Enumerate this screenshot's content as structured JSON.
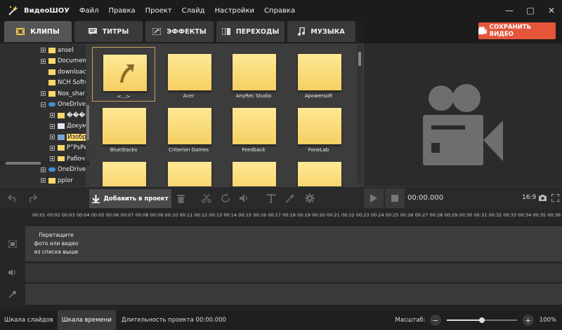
{
  "app": {
    "name": "ВидеоШОУ"
  },
  "menu": [
    "Файл",
    "Правка",
    "Проект",
    "Слайд",
    "Настройки",
    "Справка"
  ],
  "tabs": [
    {
      "label": "КЛИПЫ",
      "icon": "film-icon",
      "active": true
    },
    {
      "label": "ТИТРЫ",
      "icon": "chat-icon",
      "active": false
    },
    {
      "label": "ЭФФЕКТЫ",
      "icon": "sparkle-icon",
      "active": false
    },
    {
      "label": "ПЕРЕХОДЫ",
      "icon": "transition-icon",
      "active": false
    },
    {
      "label": "МУЗЫКА",
      "icon": "music-icon",
      "active": false
    }
  ],
  "save_button": "СОХРАНИТЬ ВИДЕО",
  "tree": [
    {
      "label": "ansel",
      "indent": 0,
      "expander": "plus",
      "icon": "folder"
    },
    {
      "label": "Documen",
      "indent": 0,
      "expander": "plus",
      "icon": "folder"
    },
    {
      "label": "downloac",
      "indent": 0,
      "expander": "none",
      "icon": "folder"
    },
    {
      "label": "NCH Softv",
      "indent": 0,
      "expander": "none",
      "icon": "folder"
    },
    {
      "label": "Nox_shar",
      "indent": 0,
      "expander": "plus",
      "icon": "folder"
    },
    {
      "label": "OneDrive",
      "indent": 0,
      "expander": "minus",
      "icon": "cloud"
    },
    {
      "label": "����",
      "indent": 1,
      "expander": "plus",
      "icon": "folder"
    },
    {
      "label": "Докум",
      "indent": 1,
      "expander": "plus",
      "icon": "doc"
    },
    {
      "label": "Изобр",
      "indent": 1,
      "expander": "plus",
      "icon": "sel",
      "selected": true
    },
    {
      "label": "Р”РsРє",
      "indent": 1,
      "expander": "plus",
      "icon": "folder"
    },
    {
      "label": "Рабоч",
      "indent": 1,
      "expander": "plus",
      "icon": "folder"
    },
    {
      "label": "OneDrive",
      "indent": 0,
      "expander": "plus",
      "icon": "cloud"
    },
    {
      "label": "pplor",
      "indent": 0,
      "expander": "plus",
      "icon": "folder"
    }
  ],
  "grid_items": [
    "<...>",
    "Acer",
    "AnyRec Studio",
    "Apowersoft",
    "BlueStacks",
    "Criterion Games",
    "Feedback",
    "FoneLab",
    "",
    "",
    "",
    ""
  ],
  "toolbar": {
    "add_label": "Добавить в проект"
  },
  "player": {
    "time": "00:00.000",
    "ratio": "16:9"
  },
  "ruler_ticks": [
    "00:01",
    "00:02",
    "00:03",
    "00:04",
    "00:05",
    "00:06",
    "00:07",
    "00:08",
    "00:09",
    "00:10",
    "00:11",
    "00:12",
    "00:13",
    "00:14",
    "00:15",
    "00:16",
    "00:17",
    "00:18",
    "00:19",
    "00:20",
    "00:21",
    "00:22",
    "00:23",
    "00:24",
    "00:25",
    "00:26",
    "00:27",
    "00:28",
    "00:29",
    "00:30",
    "00:31",
    "00:32",
    "00:33",
    "00:34",
    "00:35",
    "00:36"
  ],
  "timeline": {
    "hint_line1": "Перетащите",
    "hint_line2": "фото или видео",
    "hint_line3": "из списка выше"
  },
  "status": {
    "tab_slides": "Шкала слайдов",
    "tab_timeline": "Шкала времени",
    "project_length": "Длительность проекта 00:00.000",
    "zoom_label": "Масштаб:",
    "zoom_pct": "100%",
    "zoom_level": 0.5
  },
  "colors": {
    "accent": "#e4553a",
    "folder": "#f5cf62",
    "selection": "#ffd873"
  }
}
